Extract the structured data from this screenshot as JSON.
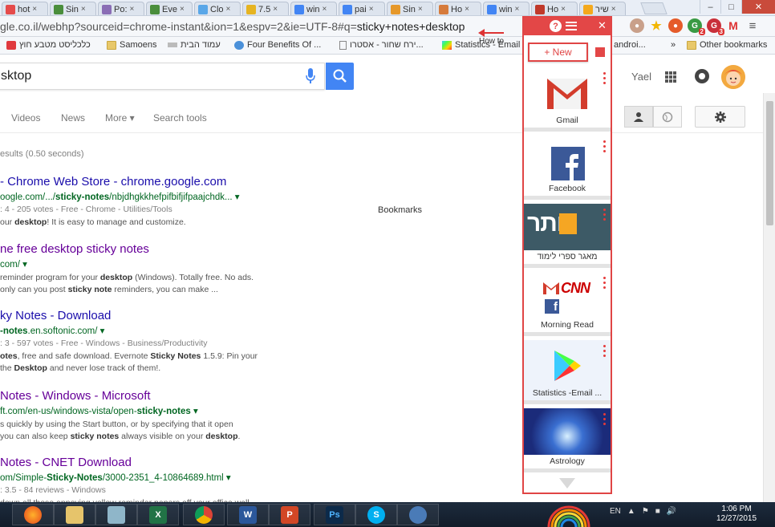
{
  "browser": {
    "tabs": [
      {
        "title": "hot",
        "icon_color": "#e54b4b",
        "icon": "mail-icon"
      },
      {
        "title": "Sin",
        "icon_color": "#4a8e3c",
        "icon": "sheet-icon"
      },
      {
        "title": "Po:",
        "icon_color": "#8a6db5",
        "icon": "m-icon"
      },
      {
        "title": "Eve",
        "icon_color": "#4a8e3c",
        "icon": "sheet-icon"
      },
      {
        "title": "Clo",
        "icon_color": "#5aa7e8",
        "icon": "cloud-icon"
      },
      {
        "title": "7.5",
        "icon_color": "#e6b422",
        "icon": "seven-icon"
      },
      {
        "title": "win",
        "icon_color": "#4285f4",
        "icon": "google-icon"
      },
      {
        "title": "pai",
        "icon_color": "#4285f4",
        "icon": "google-icon"
      },
      {
        "title": "Sin",
        "icon_color": "#e6982a",
        "icon": "square-icon"
      },
      {
        "title": "Ho",
        "icon_color": "#d67b3c",
        "icon": "circle-icon"
      },
      {
        "title": "win",
        "icon_color": "#4285f4",
        "icon": "google-icon"
      },
      {
        "title": "Ho",
        "icon_color": "#c0392b",
        "icon": "pinterest-icon"
      },
      {
        "title": "שיר",
        "icon_color": "#f4a91d",
        "icon": "face-icon"
      }
    ],
    "url_prefix": "gle.co.il/webhp?sourceid=chrome-instant&ion=1&espv=2&ie=UTF-8#q=",
    "url_query": "sticky+notes+desktop",
    "tooltip": "How to"
  },
  "bookmarks": [
    {
      "label": "כלכליסט מטבע חוץ",
      "type": "site"
    },
    {
      "label": "Samoens",
      "type": "folder"
    },
    {
      "label": "עמוד הבית",
      "type": "site"
    },
    {
      "label": "Four Benefits Of ...",
      "type": "site"
    },
    {
      "label": "ירח שחור - אסטרו...",
      "type": "page"
    },
    {
      "label": "Statistics - Email",
      "type": "site"
    },
    {
      "label": "androi...",
      "type": "site"
    },
    {
      "label": "»",
      "type": "more"
    },
    {
      "label": "Other bookmarks",
      "type": "folder"
    }
  ],
  "google": {
    "query": "sktop",
    "user": "Yael",
    "nav": [
      "Videos",
      "News",
      "More ▾",
      "Search tools"
    ],
    "stats": "esults (0.50 seconds)",
    "results": [
      {
        "title": "- Chrome Web Store - chrome.google.com",
        "visited": false,
        "url": "oogle.com/.../sticky-notes/nbjdhgkkhefpifbifjifpaajchdk... ▾",
        "meta": ": 4 - 205 votes - Free - Chrome - Utilities/Tools",
        "snippet": [
          "our desktop! It is easy to manage and customize."
        ]
      },
      {
        "title": "ne free desktop sticky notes",
        "visited": true,
        "url": "com/ ▾",
        "meta": "",
        "snippet": [
          "reminder program for your desktop (Windows). Totally free. No ads.",
          "only can you post sticky note reminders, you can make ..."
        ]
      },
      {
        "title": "ky Notes - Download",
        "visited": false,
        "url": "-notes.en.softonic.com/ ▾",
        "meta": ": 3 - 597 votes - Free - Windows - Business/Productivity",
        "snippet": [
          "otes, free and safe download. Evernote Sticky Notes 1.5.9: Pin your",
          "the Desktop and never lose track of them!."
        ]
      },
      {
        "title": "Notes - Windows - Microsoft",
        "visited": true,
        "url": "ft.com/en-us/windows-vista/open-sticky-notes ▾",
        "meta": "",
        "snippet": [
          "s quickly by using the Start button, or by specifying that it open",
          "you can also keep sticky notes always visible on your desktop."
        ]
      },
      {
        "title": "Notes - CNET Download",
        "visited": true,
        "url": "om/Simple-Sticky-Notes/3000-2351_4-10864689.html ▾",
        "meta": ": 3.5 - 84 reviews - Windows",
        "snippet": [
          "down all those annoying yellow reminder papers off your office wall"
        ]
      }
    ],
    "bookmarks_label": "Bookmarks"
  },
  "panel": {
    "new_label": "+ New",
    "items": [
      {
        "label": "Gmail",
        "icon": "gmail-icon"
      },
      {
        "label": "Facebook",
        "icon": "facebook-icon"
      },
      {
        "label": "מאגר ספרי לימוד",
        "icon": "kotar-icon",
        "logo_text": "כותר"
      },
      {
        "label": "Morning Read",
        "icon": "morning-read-icon",
        "logo_text": "CNN"
      },
      {
        "label": "Statistics -Email ...",
        "icon": "play-store-icon"
      },
      {
        "label": "Astrology",
        "icon": "astrology-icon"
      }
    ]
  },
  "taskbar": {
    "apps": [
      "firefox",
      "explorer",
      "notepad",
      "excel",
      "chrome",
      "word",
      "powerpoint",
      "photoshop",
      "skype",
      "network"
    ],
    "lang": "EN",
    "time": "1:06 PM",
    "date": "12/27/2015"
  }
}
